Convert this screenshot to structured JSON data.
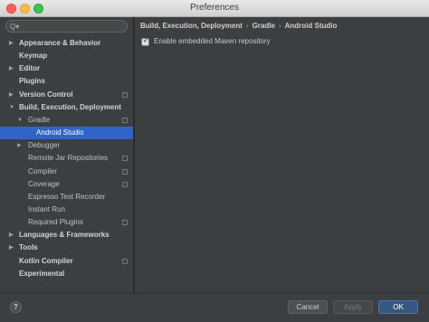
{
  "window": {
    "title": "Preferences"
  },
  "search": {
    "placeholder": "",
    "glyph": "Q▾"
  },
  "sidebar": {
    "items": [
      {
        "label": "Appearance & Behavior",
        "bold": true,
        "arrow": "right",
        "indent": 0,
        "project": false
      },
      {
        "label": "Keymap",
        "bold": true,
        "arrow": "",
        "indent": 0,
        "project": false
      },
      {
        "label": "Editor",
        "bold": true,
        "arrow": "right",
        "indent": 0,
        "project": false
      },
      {
        "label": "Plugins",
        "bold": true,
        "arrow": "",
        "indent": 0,
        "project": false
      },
      {
        "label": "Version Control",
        "bold": true,
        "arrow": "right",
        "indent": 0,
        "project": true
      },
      {
        "label": "Build, Execution, Deployment",
        "bold": true,
        "arrow": "down",
        "indent": 0,
        "project": false
      },
      {
        "label": "Gradle",
        "bold": false,
        "arrow": "down",
        "indent": 1,
        "project": true
      },
      {
        "label": "Android Studio",
        "bold": false,
        "arrow": "",
        "indent": 2,
        "project": false,
        "selected": true
      },
      {
        "label": "Debugger",
        "bold": false,
        "arrow": "right",
        "indent": 1,
        "project": false
      },
      {
        "label": "Remote Jar Repositories",
        "bold": false,
        "arrow": "",
        "indent": 1,
        "project": true
      },
      {
        "label": "Compiler",
        "bold": false,
        "arrow": "",
        "indent": 1,
        "project": true
      },
      {
        "label": "Coverage",
        "bold": false,
        "arrow": "",
        "indent": 1,
        "project": true
      },
      {
        "label": "Espresso Test Recorder",
        "bold": false,
        "arrow": "",
        "indent": 1,
        "project": false
      },
      {
        "label": "Instant Run",
        "bold": false,
        "arrow": "",
        "indent": 1,
        "project": false
      },
      {
        "label": "Required Plugins",
        "bold": false,
        "arrow": "",
        "indent": 1,
        "project": true
      },
      {
        "label": "Languages & Frameworks",
        "bold": true,
        "arrow": "right",
        "indent": 0,
        "project": false
      },
      {
        "label": "Tools",
        "bold": true,
        "arrow": "right",
        "indent": 0,
        "project": false
      },
      {
        "label": "Kotlin Compiler",
        "bold": true,
        "arrow": "",
        "indent": 0,
        "project": true
      },
      {
        "label": "Experimental",
        "bold": true,
        "arrow": "",
        "indent": 0,
        "project": false
      }
    ]
  },
  "breadcrumb": {
    "parts": [
      "Build, Execution, Deployment",
      "Gradle",
      "Android Studio"
    ],
    "separator": "›"
  },
  "settings": {
    "embedded_maven": {
      "label": "Enable embedded Maven repository",
      "checked": true,
      "mark": "✓"
    }
  },
  "footer": {
    "help": "?",
    "cancel": "Cancel",
    "apply": "Apply",
    "ok": "OK"
  },
  "colors": {
    "selection": "#2f65ca",
    "ok_button": "#365880",
    "panel": "#3c3f41"
  },
  "icons": {
    "expand_right": "▶",
    "expand_down": "▼"
  }
}
